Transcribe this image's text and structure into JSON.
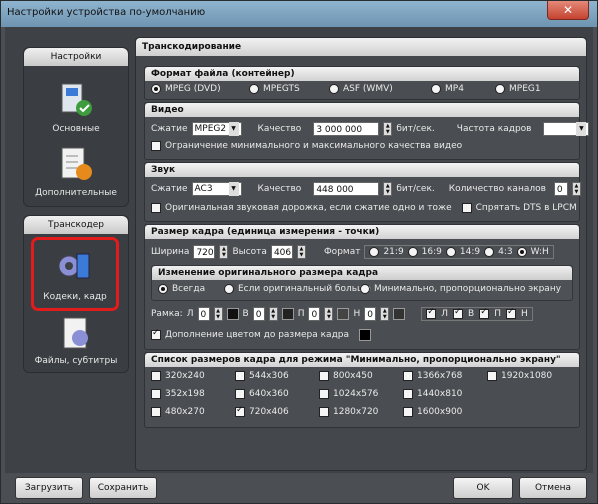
{
  "window": {
    "title": "Настройки устройства по-умолчанию",
    "close": "✕"
  },
  "sidebar": {
    "groups": [
      {
        "header": "Настройки",
        "items": [
          {
            "label": "Основные"
          },
          {
            "label": "Дополнительные"
          }
        ]
      },
      {
        "header": "Транскодер",
        "items": [
          {
            "label": "Кодеки, кадр",
            "selected": true
          },
          {
            "label": "Файлы, субтитры"
          }
        ]
      }
    ]
  },
  "main": {
    "header": "Транскодирование"
  },
  "format": {
    "header": "Формат файла (контейнер)",
    "options": [
      {
        "label": "MPEG (DVD)",
        "selected": true
      },
      {
        "label": "MPEGTS",
        "selected": false
      },
      {
        "label": "ASF (WMV)",
        "selected": false
      },
      {
        "label": "MP4",
        "selected": false
      },
      {
        "label": "MPEG1",
        "selected": false
      }
    ]
  },
  "video": {
    "header": "Видео",
    "compression_label": "Сжатие",
    "compression_value": "MPEG2",
    "quality_label": "Качество",
    "quality_value": "3 000 000",
    "quality_unit": "бит/сек.",
    "fps_label": "Частота кадров",
    "fps_value": "",
    "limit_label": "Ограничение минимального и максимального качества видео"
  },
  "audio": {
    "header": "Звук",
    "compression_label": "Сжатие",
    "compression_value": "AC3",
    "quality_label": "Качество",
    "quality_value": "448 000",
    "quality_unit": "бит/сек.",
    "channels_label": "Количество каналов",
    "channels_value": "0",
    "orig_label": "Оригинальная звуковая дорожка, если сжатие одно и тоже",
    "hide_dts_label": "Спрятать DTS в LPCM"
  },
  "frame": {
    "header": "Размер кадра (единица измерения - точки)",
    "width_label": "Ширина",
    "width_value": "720",
    "height_label": "Высота",
    "height_value": "406",
    "format_label": "Формат",
    "ratios": [
      {
        "label": "21:9",
        "selected": false
      },
      {
        "label": "16:9",
        "selected": false
      },
      {
        "label": "14:9",
        "selected": false
      },
      {
        "label": "4:3",
        "selected": false
      },
      {
        "label": "W:H",
        "selected": true
      }
    ],
    "resize": {
      "header": "Изменение оригинального размера кадра",
      "options": [
        {
          "label": "Всегда",
          "selected": true
        },
        {
          "label": "Если оригинальный больше",
          "selected": false
        },
        {
          "label": "Минимально, пропорционально экрану",
          "selected": false
        }
      ]
    },
    "frame_label": "Рамка:",
    "borders": [
      {
        "label": "Л",
        "value": "0"
      },
      {
        "label": "В",
        "value": "0"
      },
      {
        "label": "П",
        "value": "0"
      },
      {
        "label": "Н",
        "value": "0"
      }
    ],
    "border_colors": [
      "#111111",
      "#222222",
      "#444444",
      "#333333"
    ],
    "sides": [
      {
        "label": "Л",
        "checked": true
      },
      {
        "label": "В",
        "checked": true
      },
      {
        "label": "П",
        "checked": true
      },
      {
        "label": "Н",
        "checked": true
      }
    ],
    "fill_label": "Дополнение цветом до размера кадра",
    "fill_color": "#000000"
  },
  "sizes": {
    "header": "Список размеров кадра для режима \"Минимально, пропорционально экрану\"",
    "items": [
      {
        "label": "320x240",
        "checked": false
      },
      {
        "label": "544x306",
        "checked": false
      },
      {
        "label": "800x450",
        "checked": false
      },
      {
        "label": "1366x768",
        "checked": false
      },
      {
        "label": "1920x1080",
        "checked": false
      },
      {
        "label": "352x198",
        "checked": false
      },
      {
        "label": "640x360",
        "checked": false
      },
      {
        "label": "1024x576",
        "checked": false
      },
      {
        "label": "1440x810",
        "checked": false
      },
      {
        "label": "480x270",
        "checked": false
      },
      {
        "label": "720x406",
        "checked": true
      },
      {
        "label": "1280x720",
        "checked": false
      },
      {
        "label": "1600x900",
        "checked": false
      }
    ]
  },
  "buttons": {
    "load": "Загрузить",
    "save": "Сохранить",
    "ok": "OK",
    "cancel": "Отмена"
  },
  "colors": {
    "highlight": "#e21b1b",
    "panel_bg": "#4a4d51"
  }
}
